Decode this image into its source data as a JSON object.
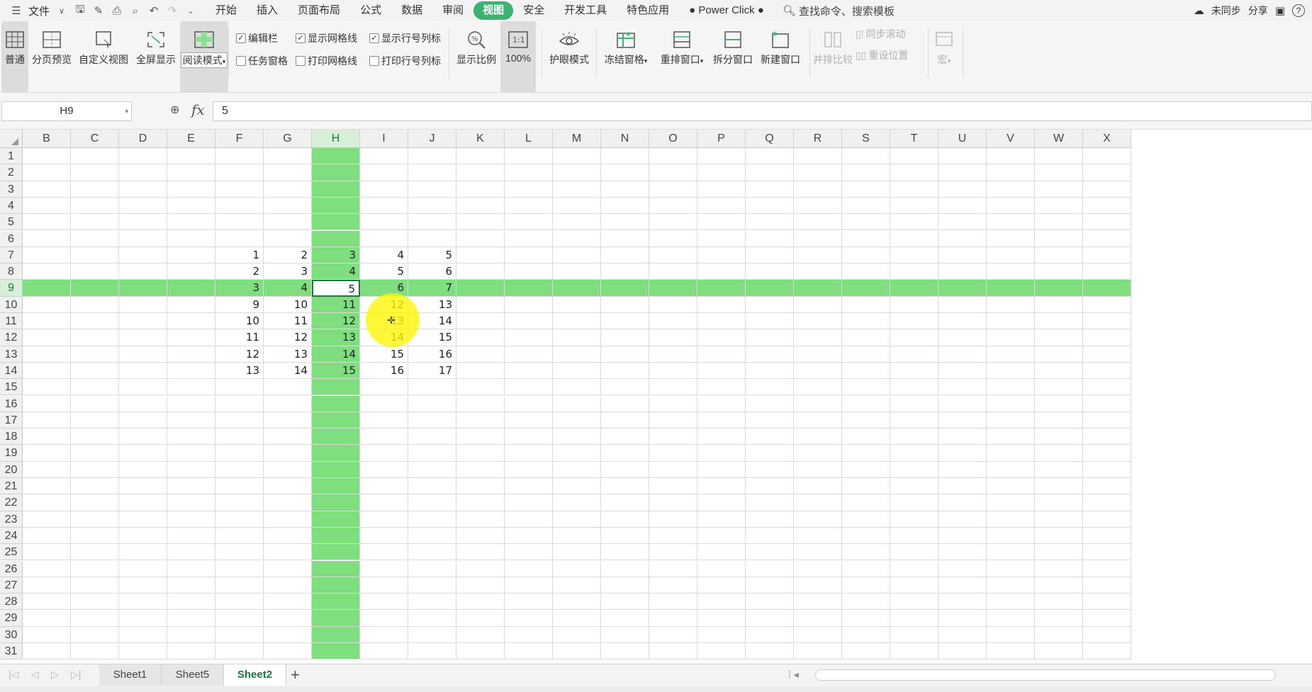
{
  "menubar": {
    "file_label": "文件",
    "tabs": [
      "开始",
      "插入",
      "页面布局",
      "公式",
      "数据",
      "审阅",
      "视图",
      "安全",
      "开发工具",
      "特色应用",
      "● Power Click ●"
    ],
    "active_tab": "视图",
    "search_label": "查找命令、搜索模板",
    "sync_label": "未同步",
    "share_label": "分享",
    "help_label": "?"
  },
  "ribbon": {
    "normal": "普通",
    "page_break_preview": "分页预览",
    "custom_view": "自定义视图",
    "fullscreen": "全屏显示",
    "reading_mode": "阅读模式",
    "checks": {
      "formula_bar": "编辑栏",
      "task_pane": "任务窗格",
      "show_gridlines": "显示网格线",
      "print_gridlines": "打印网格线",
      "show_headings": "显示行号列标",
      "print_headings": "打印行号列标"
    },
    "zoom": "显示比例",
    "zoom_100": "100%",
    "eye_protection": "护眼模式",
    "freeze_panes": "冻结窗格",
    "arrange_windows": "重排窗口",
    "split_window": "拆分窗口",
    "new_window": "新建窗口",
    "side_by_side": "并排比较",
    "sync_scroll": "同步滚动",
    "reset_position": "重设位置",
    "macro": "宏"
  },
  "formula": {
    "name_box": "H9",
    "fx": "fx",
    "value": "5"
  },
  "sheet": {
    "columns": [
      "B",
      "C",
      "D",
      "E",
      "F",
      "G",
      "H",
      "I",
      "J",
      "K",
      "L",
      "M",
      "N",
      "O",
      "P",
      "Q",
      "R",
      "S",
      "T",
      "U",
      "V",
      "W",
      "X"
    ],
    "rows": [
      "1",
      "2",
      "3",
      "4",
      "5",
      "6",
      "7",
      "8",
      "9",
      "10",
      "11",
      "12",
      "13",
      "14",
      "15",
      "16",
      "17",
      "18",
      "19",
      "20",
      "21",
      "22",
      "23",
      "24",
      "25",
      "26",
      "27",
      "28",
      "29",
      "30",
      "31"
    ],
    "highlight_color": "#7fdf7f",
    "selected_column": "H",
    "selected_row": "9",
    "values": {
      "7": {
        "F": "1",
        "G": "2",
        "H": "3",
        "I": "4",
        "J": "5"
      },
      "8": {
        "F": "2",
        "G": "3",
        "H": "4",
        "I": "5",
        "J": "6"
      },
      "9": {
        "F": "3",
        "G": "4",
        "H": "5",
        "I": "6",
        "J": "7"
      },
      "10": {
        "F": "9",
        "G": "10",
        "H": "11",
        "I": "12",
        "J": "13"
      },
      "11": {
        "F": "10",
        "G": "11",
        "H": "12",
        "I": "13",
        "J": "14"
      },
      "12": {
        "F": "11",
        "G": "12",
        "H": "13",
        "I": "14",
        "J": "15"
      },
      "13": {
        "F": "12",
        "G": "13",
        "H": "14",
        "I": "15",
        "J": "16"
      },
      "14": {
        "F": "13",
        "G": "14",
        "H": "15",
        "I": "16",
        "J": "17"
      }
    }
  },
  "sheet_tabs": [
    "Sheet1",
    "Sheet5",
    "Sheet2"
  ],
  "active_sheet": "Sheet2"
}
